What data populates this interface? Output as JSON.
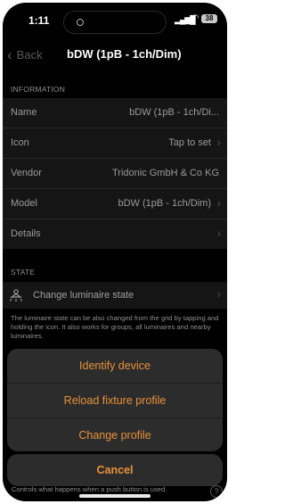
{
  "status_bar": {
    "time": "1:11",
    "battery": "38"
  },
  "nav": {
    "back_label": "Back",
    "title": "bDW (1pB - 1ch/Dim)"
  },
  "information": {
    "header": "INFORMATION",
    "rows": [
      {
        "label": "Name",
        "value": "bDW (1pB - 1ch/Di..."
      },
      {
        "label": "Icon",
        "value": "Tap to set"
      },
      {
        "label": "Vendor",
        "value": "Tridonic GmbH & Co KG"
      },
      {
        "label": "Model",
        "value": "bDW (1pB - 1ch/Dim)"
      },
      {
        "label": "Details",
        "value": ""
      }
    ]
  },
  "state": {
    "header": "STATE",
    "change_label": "Change luminaire state",
    "footnote": "The luminaire state can be also changed from the grid by tapping and holding the icon. It also works for groups, all luminaires and nearby luminaires."
  },
  "action_sheet": {
    "items": [
      "Identify device",
      "Reload fixture profile",
      "Change profile"
    ],
    "cancel": "Cancel"
  },
  "bottom_note": "Controls what happens when a push button is used.",
  "help_symbol": "?",
  "colors": {
    "accent": "#e8923a",
    "background": "#000000",
    "cell": "#151515",
    "sheet": "#2c2c2c"
  }
}
